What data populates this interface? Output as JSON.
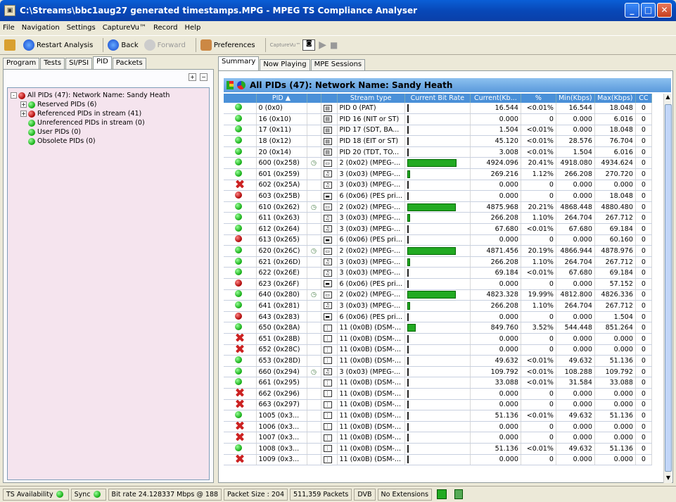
{
  "window": {
    "title": "C:\\Streams\\bbc1aug27 generated timestamps.MPG - MPEG TS Compliance Analyser"
  },
  "menu": [
    "File",
    "Navigation",
    "Settings",
    "CaptureVu™",
    "Record",
    "Help"
  ],
  "toolbar": {
    "restart": "Restart Analysis",
    "back": "Back",
    "forward": "Forward",
    "preferences": "Preferences",
    "capture": "CaptureVu™"
  },
  "left_tabs": [
    "Program",
    "Tests",
    "SI/PSI",
    "PID",
    "Packets"
  ],
  "tree": [
    {
      "label": "All PIDs (47): Network Name: Sandy Heath",
      "status": "red",
      "indent": 0,
      "expander": "-"
    },
    {
      "label": "Reserved PIDs (6)",
      "status": "green",
      "indent": 1,
      "expander": "+"
    },
    {
      "label": "Referenced PIDs in stream (41)",
      "status": "red",
      "indent": 1,
      "expander": "+"
    },
    {
      "label": "Unreferenced PIDs in stream (0)",
      "status": "green",
      "indent": 1,
      "expander": ""
    },
    {
      "label": "User PIDs (0)",
      "status": "green",
      "indent": 1,
      "expander": ""
    },
    {
      "label": "Obsolete PIDs (0)",
      "status": "green",
      "indent": 1,
      "expander": ""
    }
  ],
  "right_tabs": [
    "Summary",
    "Now Playing",
    "MPE Sessions"
  ],
  "header": {
    "title": "All PIDs (47): Network Name: Sandy Heath"
  },
  "columns": [
    "",
    "PID ▲",
    "",
    "",
    "Stream type",
    "Current Bit Rate",
    "Current(Kb...",
    "%",
    "Min(Kbps)",
    "Max(Kbps)",
    "CC"
  ],
  "rows": [
    {
      "st": "green",
      "pid": "0 (0x0)",
      "clk": false,
      "ic": "t",
      "type": "PID 0 (PAT)",
      "bar": 0,
      "cur": "16.544",
      "pct": "<0.01%",
      "min": "16.544",
      "max": "18.048",
      "cc": "0"
    },
    {
      "st": "green",
      "pid": "16 (0x10)",
      "clk": false,
      "ic": "t",
      "type": "PID 16 (NIT or ST)",
      "bar": 0,
      "cur": "0.000",
      "pct": "0",
      "min": "0.000",
      "max": "6.016",
      "cc": "0"
    },
    {
      "st": "green",
      "pid": "17 (0x11)",
      "clk": false,
      "ic": "t",
      "type": "PID 17 (SDT, BA...",
      "bar": 0,
      "cur": "1.504",
      "pct": "<0.01%",
      "min": "0.000",
      "max": "18.048",
      "cc": "0"
    },
    {
      "st": "green",
      "pid": "18 (0x12)",
      "clk": false,
      "ic": "t",
      "type": "PID 18 (EIT or ST)",
      "bar": 0,
      "cur": "45.120",
      "pct": "<0.01%",
      "min": "28.576",
      "max": "76.704",
      "cc": "0"
    },
    {
      "st": "green",
      "pid": "20 (0x14)",
      "clk": false,
      "ic": "t",
      "type": "PID 20 (TDT, TO...",
      "bar": 0,
      "cur": "3.008",
      "pct": "<0.01%",
      "min": "1.504",
      "max": "6.016",
      "cc": "0"
    },
    {
      "st": "green",
      "pid": "600 (0x258)",
      "clk": true,
      "ic": "v",
      "type": "2 (0x02) (MPEG-...",
      "bar": 20.41,
      "cur": "4924.096",
      "pct": "20.41%",
      "min": "4918.080",
      "max": "4934.624",
      "cc": "0"
    },
    {
      "st": "green",
      "pid": "601 (0x259)",
      "clk": false,
      "ic": "a",
      "type": "3 (0x03) (MPEG-...",
      "bar": 1.12,
      "cur": "269.216",
      "pct": "1.12%",
      "min": "266.208",
      "max": "270.720",
      "cc": "0"
    },
    {
      "st": "x",
      "pid": "602 (0x25A)",
      "clk": false,
      "ic": "a",
      "type": "3 (0x03) (MPEG-...",
      "bar": 0,
      "cur": "0.000",
      "pct": "0",
      "min": "0.000",
      "max": "0.000",
      "cc": "0"
    },
    {
      "st": "red",
      "pid": "603 (0x25B)",
      "clk": false,
      "ic": "p",
      "type": "6 (0x06) (PES pri...",
      "bar": 0,
      "cur": "0.000",
      "pct": "0",
      "min": "0.000",
      "max": "18.048",
      "cc": "0"
    },
    {
      "st": "green",
      "pid": "610 (0x262)",
      "clk": true,
      "ic": "v",
      "type": "2 (0x02) (MPEG-...",
      "bar": 20.21,
      "cur": "4875.968",
      "pct": "20.21%",
      "min": "4868.448",
      "max": "4880.480",
      "cc": "0"
    },
    {
      "st": "green",
      "pid": "611 (0x263)",
      "clk": false,
      "ic": "a",
      "type": "3 (0x03) (MPEG-...",
      "bar": 1.1,
      "cur": "266.208",
      "pct": "1.10%",
      "min": "264.704",
      "max": "267.712",
      "cc": "0"
    },
    {
      "st": "green",
      "pid": "612 (0x264)",
      "clk": false,
      "ic": "a",
      "type": "3 (0x03) (MPEG-...",
      "bar": 0,
      "cur": "67.680",
      "pct": "<0.01%",
      "min": "67.680",
      "max": "69.184",
      "cc": "0"
    },
    {
      "st": "red",
      "pid": "613 (0x265)",
      "clk": false,
      "ic": "p",
      "type": "6 (0x06) (PES pri...",
      "bar": 0,
      "cur": "0.000",
      "pct": "0",
      "min": "0.000",
      "max": "60.160",
      "cc": "0"
    },
    {
      "st": "green",
      "pid": "620 (0x26C)",
      "clk": true,
      "ic": "v",
      "type": "2 (0x02) (MPEG-...",
      "bar": 20.19,
      "cur": "4871.456",
      "pct": "20.19%",
      "min": "4866.944",
      "max": "4878.976",
      "cc": "0"
    },
    {
      "st": "green",
      "pid": "621 (0x26D)",
      "clk": false,
      "ic": "a",
      "type": "3 (0x03) (MPEG-...",
      "bar": 1.1,
      "cur": "266.208",
      "pct": "1.10%",
      "min": "264.704",
      "max": "267.712",
      "cc": "0"
    },
    {
      "st": "green",
      "pid": "622 (0x26E)",
      "clk": false,
      "ic": "a",
      "type": "3 (0x03) (MPEG-...",
      "bar": 0,
      "cur": "69.184",
      "pct": "<0.01%",
      "min": "67.680",
      "max": "69.184",
      "cc": "0"
    },
    {
      "st": "red",
      "pid": "623 (0x26F)",
      "clk": false,
      "ic": "p",
      "type": "6 (0x06) (PES pri...",
      "bar": 0,
      "cur": "0.000",
      "pct": "0",
      "min": "0.000",
      "max": "57.152",
      "cc": "0"
    },
    {
      "st": "green",
      "pid": "640 (0x280)",
      "clk": true,
      "ic": "v",
      "type": "2 (0x02) (MPEG-...",
      "bar": 19.99,
      "cur": "4823.328",
      "pct": "19.99%",
      "min": "4812.800",
      "max": "4826.336",
      "cc": "0"
    },
    {
      "st": "green",
      "pid": "641 (0x281)",
      "clk": false,
      "ic": "a",
      "type": "3 (0x03) (MPEG-...",
      "bar": 1.1,
      "cur": "266.208",
      "pct": "1.10%",
      "min": "264.704",
      "max": "267.712",
      "cc": "0"
    },
    {
      "st": "red",
      "pid": "643 (0x283)",
      "clk": false,
      "ic": "p",
      "type": "6 (0x06) (PES pri...",
      "bar": 0,
      "cur": "0.000",
      "pct": "0",
      "min": "0.000",
      "max": "1.504",
      "cc": "0"
    },
    {
      "st": "green",
      "pid": "650 (0x28A)",
      "clk": false,
      "ic": "d",
      "type": "11 (0x0B) (DSM-...",
      "bar": 3.52,
      "cur": "849.760",
      "pct": "3.52%",
      "min": "544.448",
      "max": "851.264",
      "cc": "0"
    },
    {
      "st": "x",
      "pid": "651 (0x28B)",
      "clk": false,
      "ic": "d",
      "type": "11 (0x0B) (DSM-...",
      "bar": 0,
      "cur": "0.000",
      "pct": "0",
      "min": "0.000",
      "max": "0.000",
      "cc": "0"
    },
    {
      "st": "x",
      "pid": "652 (0x28C)",
      "clk": false,
      "ic": "d",
      "type": "11 (0x0B) (DSM-...",
      "bar": 0,
      "cur": "0.000",
      "pct": "0",
      "min": "0.000",
      "max": "0.000",
      "cc": "0"
    },
    {
      "st": "green",
      "pid": "653 (0x28D)",
      "clk": false,
      "ic": "d",
      "type": "11 (0x0B) (DSM-...",
      "bar": 0,
      "cur": "49.632",
      "pct": "<0.01%",
      "min": "49.632",
      "max": "51.136",
      "cc": "0"
    },
    {
      "st": "green",
      "pid": "660 (0x294)",
      "clk": true,
      "ic": "a",
      "type": "3 (0x03) (MPEG-...",
      "bar": 0,
      "cur": "109.792",
      "pct": "<0.01%",
      "min": "108.288",
      "max": "109.792",
      "cc": "0"
    },
    {
      "st": "green",
      "pid": "661 (0x295)",
      "clk": false,
      "ic": "d",
      "type": "11 (0x0B) (DSM-...",
      "bar": 0,
      "cur": "33.088",
      "pct": "<0.01%",
      "min": "31.584",
      "max": "33.088",
      "cc": "0"
    },
    {
      "st": "x",
      "pid": "662 (0x296)",
      "clk": false,
      "ic": "d",
      "type": "11 (0x0B) (DSM-...",
      "bar": 0,
      "cur": "0.000",
      "pct": "0",
      "min": "0.000",
      "max": "0.000",
      "cc": "0"
    },
    {
      "st": "x",
      "pid": "663 (0x297)",
      "clk": false,
      "ic": "d",
      "type": "11 (0x0B) (DSM-...",
      "bar": 0,
      "cur": "0.000",
      "pct": "0",
      "min": "0.000",
      "max": "0.000",
      "cc": "0"
    },
    {
      "st": "green",
      "pid": "1005 (0x3...",
      "clk": false,
      "ic": "d",
      "type": "11 (0x0B) (DSM-...",
      "bar": 0,
      "cur": "51.136",
      "pct": "<0.01%",
      "min": "49.632",
      "max": "51.136",
      "cc": "0"
    },
    {
      "st": "x",
      "pid": "1006 (0x3...",
      "clk": false,
      "ic": "d",
      "type": "11 (0x0B) (DSM-...",
      "bar": 0,
      "cur": "0.000",
      "pct": "0",
      "min": "0.000",
      "max": "0.000",
      "cc": "0"
    },
    {
      "st": "x",
      "pid": "1007 (0x3...",
      "clk": false,
      "ic": "d",
      "type": "11 (0x0B) (DSM-...",
      "bar": 0,
      "cur": "0.000",
      "pct": "0",
      "min": "0.000",
      "max": "0.000",
      "cc": "0"
    },
    {
      "st": "green",
      "pid": "1008 (0x3...",
      "clk": false,
      "ic": "d",
      "type": "11 (0x0B) (DSM-...",
      "bar": 0,
      "cur": "51.136",
      "pct": "<0.01%",
      "min": "49.632",
      "max": "51.136",
      "cc": "0"
    },
    {
      "st": "x",
      "pid": "1009 (0x3...",
      "clk": false,
      "ic": "d",
      "type": "11 (0x0B) (DSM-...",
      "bar": 0,
      "cur": "0.000",
      "pct": "0",
      "min": "0.000",
      "max": "0.000",
      "cc": "0"
    }
  ],
  "status": {
    "ts": "TS Availability",
    "sync": "Sync",
    "bitrate": "Bit rate  24.128337 Mbps @ 188",
    "packet_size": "Packet Size : 204",
    "packets": "511,359 Packets",
    "dvb": "DVB",
    "ext": "No Extensions"
  }
}
